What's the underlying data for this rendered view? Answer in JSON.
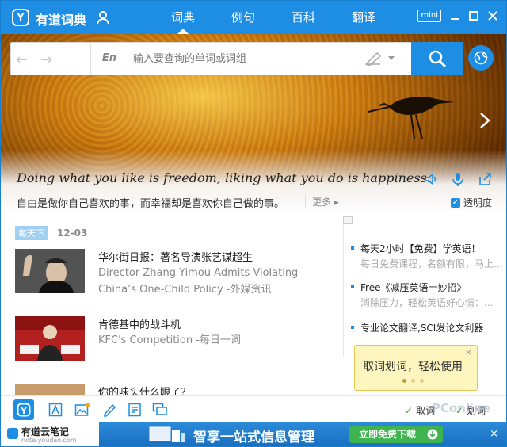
{
  "app": {
    "title": "有道词典"
  },
  "nav": {
    "tabs": [
      "词典",
      "例句",
      "百科",
      "翻译"
    ],
    "active": 0
  },
  "window_controls": {
    "mini": "mini"
  },
  "search": {
    "lang": "En",
    "placeholder": "输入要查询的单词或词组"
  },
  "quote": {
    "en": "Doing what you like is freedom, liking what you do is happiness.",
    "cn": "自由是做你自己喜欢的事，而幸福却是喜欢你自己做的事。",
    "more": "更多",
    "transparency": "透明度"
  },
  "news": {
    "date_badge": "每天下",
    "date": "12-03",
    "items": [
      {
        "title": "华尔街日报：著名导演张艺谋超生",
        "subtitle": "Director Zhang Yimou Admits Violating China’s One-Child Policy -外媒资讯"
      },
      {
        "title": "肯德基中的战斗机",
        "subtitle": "KFC's Competition -每日一词"
      },
      {
        "title": "你的味头什么眼了？",
        "subtitle": ""
      }
    ]
  },
  "sidebar": {
    "items": [
      {
        "title": "每天2小时【免费】学英语！",
        "desc": "每日免费课程，名额有限，马上..."
      },
      {
        "title": "Free《减压英语十妙招》",
        "desc": "消除压力，轻松英语好心情：..."
      },
      {
        "title": "专业论文翻译,SCI发论文利器",
        "desc": ""
      }
    ]
  },
  "tooltip": {
    "text": "取词划词，轻松使用",
    "close": "×"
  },
  "toolbar": {
    "quci": "取词",
    "huaci": "划词"
  },
  "adbar": {
    "logo_name": "有道云笔记",
    "logo_url": "note.youdao.com",
    "slogan": "智享一站式信息管理",
    "button": "立即免费下载",
    "close": "×"
  },
  "watermark": "PConline",
  "colors": {
    "brand_blue": "#1d8ee3",
    "green": "#3fb34f",
    "tooltip_bg": "#fff6bf"
  }
}
